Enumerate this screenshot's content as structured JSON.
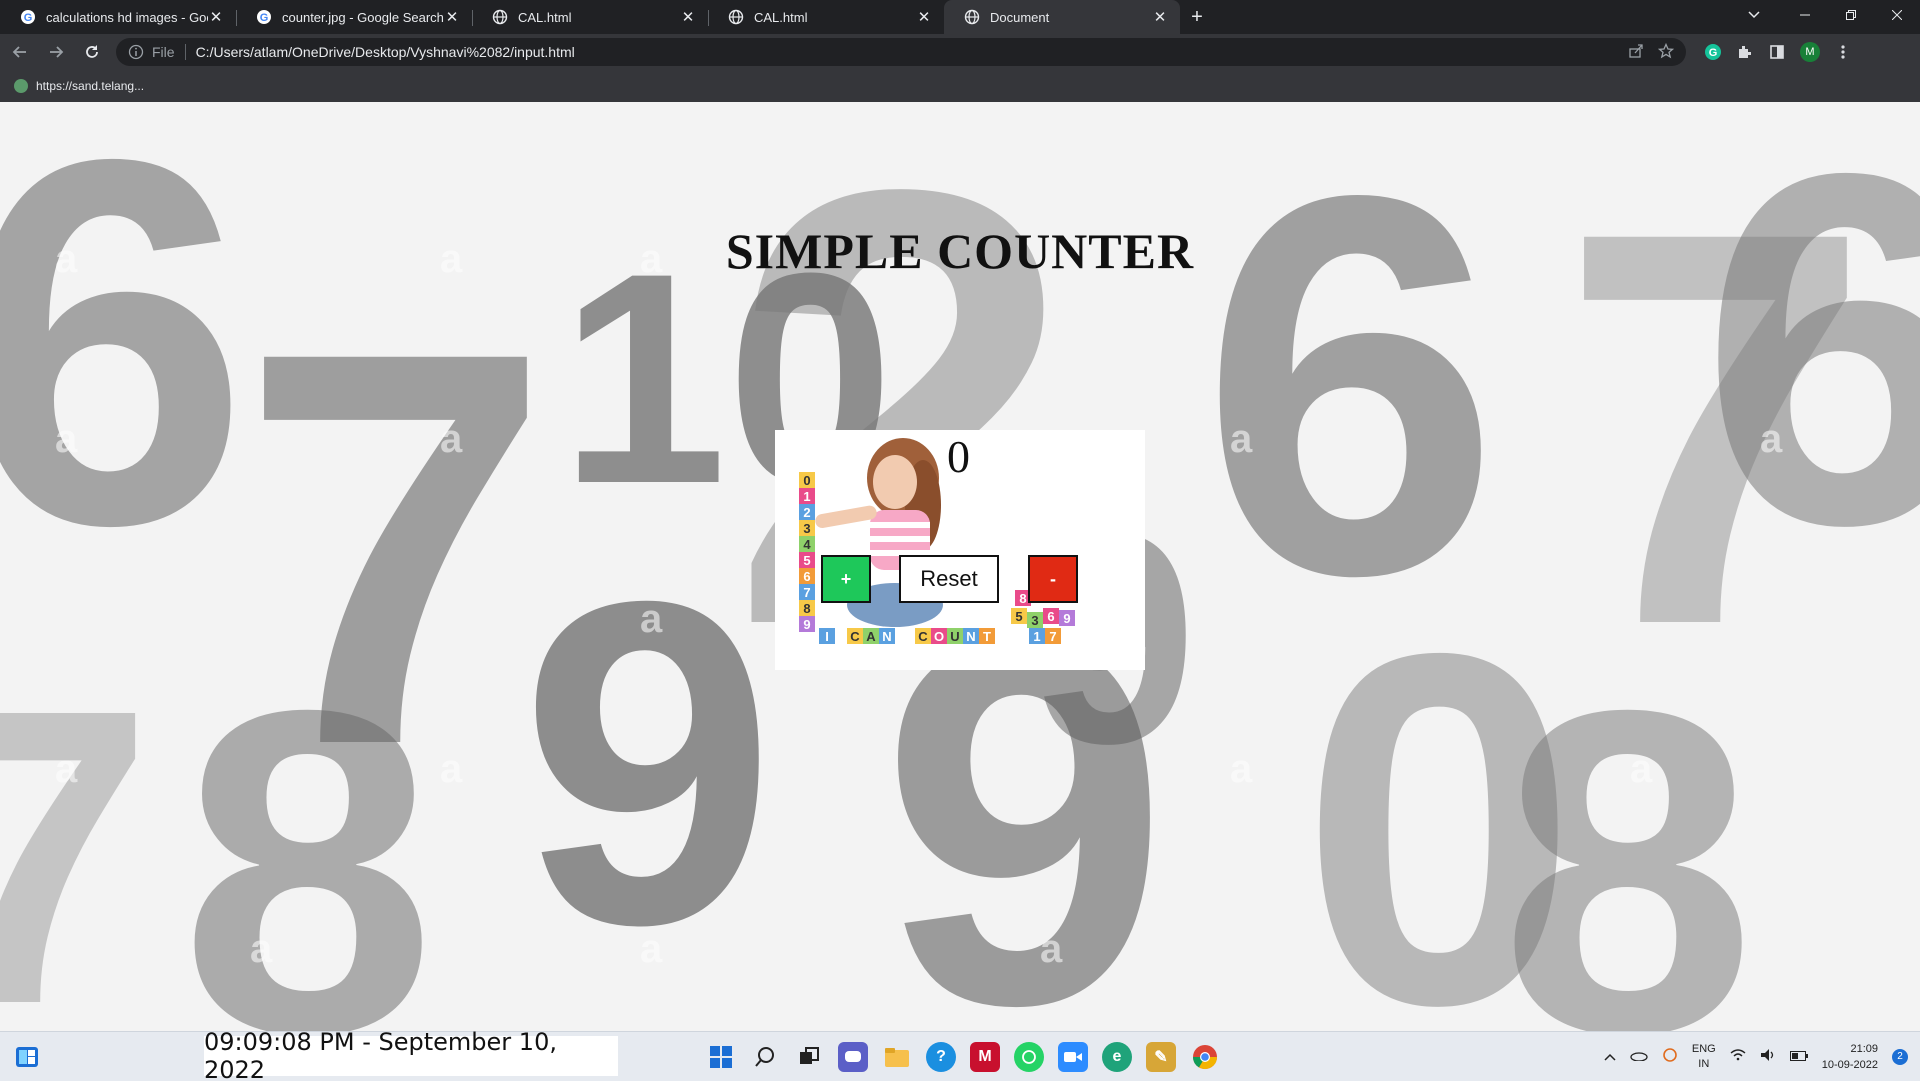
{
  "browser": {
    "tabs": [
      {
        "title": "calculations hd images - Google",
        "favicon": "google-g-icon",
        "active": false
      },
      {
        "title": "counter.jpg - Google Search",
        "favicon": "google-g-icon",
        "active": false
      },
      {
        "title": "CAL.html",
        "favicon": "globe-icon",
        "active": false
      },
      {
        "title": "CAL.html",
        "favicon": "globe-icon",
        "active": false
      },
      {
        "title": "Document",
        "favicon": "globe-icon",
        "active": true
      }
    ],
    "new_tab_label": "+",
    "address": {
      "scheme_label": "File",
      "url": "C:/Users/atlam/OneDrive/Desktop/Vyshnavi%2082/input.html"
    },
    "profile_initial": "M",
    "bookmark": {
      "label": "https://sand.telang..."
    }
  },
  "page": {
    "heading": "SIMPLE COUNTER",
    "count": "0",
    "buttons": {
      "increment": "+",
      "reset": "Reset",
      "decrement": "-"
    },
    "image_text": "I CAN COUNT"
  },
  "taskbar": {
    "clock_widget": "09:09:08 PM - September 10, 2022",
    "language": "ENG",
    "region": "IN",
    "time": "21:09",
    "date": "10-09-2022",
    "notification_count": "2"
  },
  "colors": {
    "increment_bg": "#1ec85a",
    "decrement_bg": "#e02a14",
    "chrome_dark": "#202124",
    "chrome_toolbar": "#35363a"
  }
}
